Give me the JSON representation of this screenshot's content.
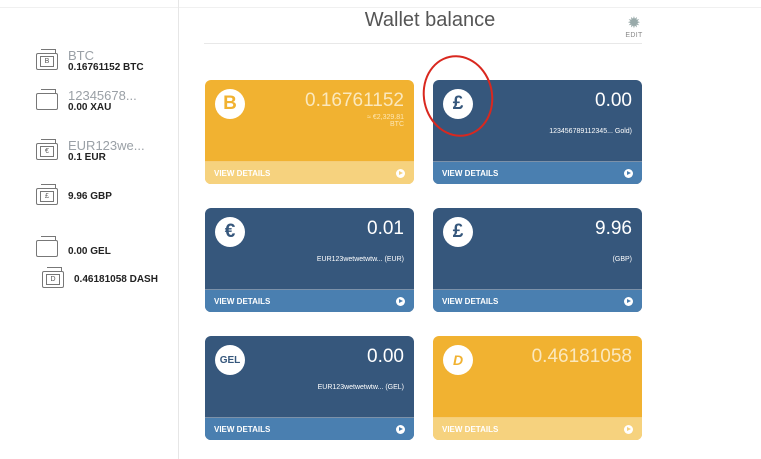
{
  "header": {
    "title": "Wallet balance",
    "edit_label": "EDIT",
    "edit_icon": "gear-icon"
  },
  "sidebar": {
    "items": [
      {
        "symbol": "B",
        "name": "BTC",
        "balance": "0.16761152 BTC"
      },
      {
        "symbol": "",
        "name": "12345678...",
        "balance": "0.00 XAU"
      },
      {
        "symbol": "€",
        "name": "EUR123we...",
        "balance": "0.1 EUR"
      },
      {
        "symbol": "£",
        "name": "",
        "balance": "9.96 GBP"
      },
      {
        "symbol": "",
        "name": "",
        "balance": "0.00 GEL"
      },
      {
        "symbol": "D",
        "name": "",
        "balance": "0.46181058 DASH"
      }
    ]
  },
  "cards": [
    {
      "icon": "bitcoin-icon",
      "symbol": "B",
      "amount": "0.16761152",
      "sub1": "≈ €2,329.81",
      "sub2": "BTC",
      "footer": "VIEW DETAILS",
      "color": "#f1b231"
    },
    {
      "icon": "pound-icon",
      "symbol": "£",
      "amount": "0.00",
      "sub1": "123456789112345... Gold)",
      "sub2": "",
      "footer": "VIEW DETAILS",
      "color": "#36577c"
    },
    {
      "icon": "euro-icon",
      "symbol": "€",
      "amount": "0.01",
      "sub1": "EUR123wetwetwtw... (EUR)",
      "sub2": "",
      "footer": "VIEW DETAILS",
      "color": "#36577c"
    },
    {
      "icon": "pound-icon",
      "symbol": "£",
      "amount": "9.96",
      "sub1": "(GBP)",
      "sub2": "",
      "footer": "VIEW DETAILS",
      "color": "#36577c"
    },
    {
      "icon": "gel-icon",
      "symbol": "GEL",
      "amount": "0.00",
      "sub1": "EUR123wetwetwtw... (GEL)",
      "sub2": "",
      "footer": "VIEW DETAILS",
      "color": "#36577c"
    },
    {
      "icon": "dash-icon",
      "symbol": "D",
      "amount": "0.46181058",
      "sub1": "",
      "sub2": "",
      "footer": "VIEW DETAILS",
      "color": "#f1b231"
    }
  ]
}
